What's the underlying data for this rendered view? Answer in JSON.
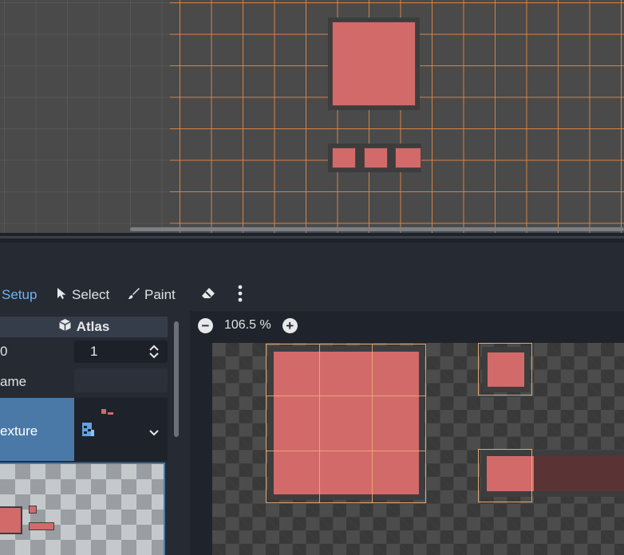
{
  "toolbar": {
    "setup_label": "Setup",
    "select_label": "Select",
    "paint_label": "Paint",
    "active_color": "#6fb3f2"
  },
  "atlas": {
    "header": "Atlas",
    "id_label": "0",
    "id_value": "1",
    "name_label": "ame",
    "name_value": "",
    "texture_label": "exture"
  },
  "zoom": {
    "level": "106.5 %"
  },
  "colors": {
    "tile_fill": "#d26a6a",
    "tile_border": "#3d3d3d",
    "grid_line": "#ec8c46",
    "selection_blue": "#4a79a8"
  }
}
